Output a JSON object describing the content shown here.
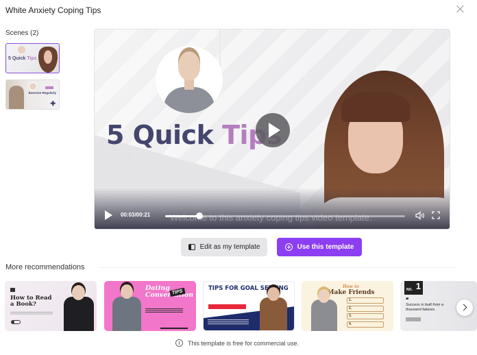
{
  "dialog": {
    "title": "White Anxiety Coping Tips",
    "close_icon": "close-icon"
  },
  "scenes": {
    "label": "Scenes (2)",
    "items": [
      {
        "title_main": "5 Quick",
        "title_accent": "Tips",
        "selected": true
      },
      {
        "title_main": "Exercise Regularly",
        "badge": "NO.1",
        "selected": false
      }
    ]
  },
  "player": {
    "headline_main": "5 Quick",
    "headline_accent": "Tips",
    "subtitle": "Welcome to this anxiety coping tips video template.",
    "time": "00:03/00:21",
    "progress_fraction": 0.143,
    "icons": {
      "play": "play-icon",
      "volume": "volume-icon",
      "fullscreen": "fullscreen-icon"
    },
    "colors": {
      "headline": "#45466e",
      "accent": "#b47ebe"
    }
  },
  "actions": {
    "edit_label": "Edit as my template",
    "use_label": "Use this template",
    "primary_color": "#8b3ef2"
  },
  "recommendations": {
    "label": "More recommendations",
    "cards": [
      {
        "title": "How to Read a Book?"
      },
      {
        "title": "Dating Conversation",
        "tag": "TIPS"
      },
      {
        "title": "TIPS FOR GOAL SETTING"
      },
      {
        "title": "Make Friends",
        "kicker": "How to",
        "steps": [
          "1.",
          "2.",
          "3.",
          "4."
        ]
      },
      {
        "badge_small": "NO.",
        "badge_number": "1",
        "quote_mark": "❝",
        "quote": "Success is built from a thousand failures."
      }
    ],
    "next_icon": "chevron-right-icon"
  },
  "footer": {
    "notice": "This template is free for commercial use."
  }
}
